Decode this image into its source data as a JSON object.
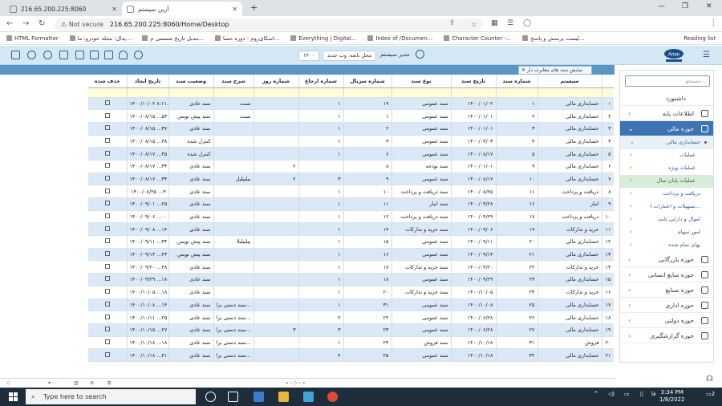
{
  "browser": {
    "tab1_title": "216.65.200.225:8060",
    "tab2_title": "آرین سیستم",
    "address_secure": "Not secure",
    "address_url": "216.65.200.225:8060/Home/Desktop",
    "bookmarks": [
      "HTML Formatter",
      "پدال: مجله خودرو، ما...",
      "تبدیل تاریخ شمسی م...",
      "اسکای‌روم - دوره حسا...",
      "Everything | Digital...",
      "Index of /Documen...",
      "Character Counter -...",
      "لیست پرسش و پاسخ..."
    ],
    "reading_list": "Reading list"
  },
  "app": {
    "logo_text": "Arian",
    "user_label": "مدیر سیستم",
    "branch_label": "محل تابعه: وب جدید",
    "year_label": "۱۴۰۰",
    "doc_tab": "نمایش سند های مغایرت دار"
  },
  "sidebar": {
    "search_placeholder": "جستجو...",
    "items": [
      {
        "label": "داشبورد"
      },
      {
        "label": "اطلاعات پایه"
      },
      {
        "label": "حوزه مالی"
      },
      {
        "label": "حسابداری مالی"
      },
      {
        "label": "عملیات"
      },
      {
        "label": "عملیات ویژه"
      },
      {
        "label": "عملیات پایان سال"
      },
      {
        "label": "دریافت و پرداخت"
      },
      {
        "label": "تسهیلات و اعتبارات ا..."
      },
      {
        "label": "اموال و دارایی ثابت"
      },
      {
        "label": "امور سهام"
      },
      {
        "label": "بهای تمام شده"
      },
      {
        "label": "حوزه بازرگانی"
      },
      {
        "label": "حوزه منابع انسانی"
      },
      {
        "label": "حوزه صنایع"
      },
      {
        "label": "حوزه اداری"
      },
      {
        "label": "حوزه دولتی"
      },
      {
        "label": "حوزه گزارشگیری"
      }
    ]
  },
  "grid": {
    "headers": [
      "",
      "سیستم",
      "شماره سند",
      "تاریخ سند",
      "نوع سند",
      "شماره سریال",
      "شماره ارجاع",
      "شماره روز",
      "شرح سند",
      "وضعیت سند",
      "تاریخ ایجاد",
      "حذف شده"
    ],
    "rows": [
      [
        "۱",
        "حسابداری مالی",
        "۱",
        "۱۴۰۰/۰۱/۰۲",
        "سند عمومی",
        "۱۹",
        "۱",
        "",
        "تست",
        "سند عادی",
        "۱۴۰۰/۱۰/۰۲ ۸:۱۱..."
      ],
      [
        "۲",
        "حسابداری مالی",
        "۲",
        "۱۴۰۰/۰۱/۰۱",
        "سند عمومی",
        "۱",
        "۱",
        "",
        "تست",
        "سند پیش نویس",
        "۱۴۰۰/۰۸/۱۵ ...۵۳"
      ],
      [
        "۳",
        "حسابداری مالی",
        "۳",
        "۱۴۰۰/۰۱/۰۱",
        "سند عمومی",
        "۲",
        "۱",
        "",
        "",
        "سند عادی",
        "۱۴۰۰/۰۸/۱۵ ...۳۷"
      ],
      [
        "۴",
        "حسابداری مالی",
        "۴",
        "۱۴۰۰/۰۳/۰۳",
        "سند عمومی",
        "۳",
        "۱",
        "",
        "",
        "کنترل شده",
        "۱۴۰۰/۰۸/۱۵ ...۳۸"
      ],
      [
        "۵",
        "حسابداری مالی",
        "۵",
        "۱۴۰۰/۰۸/۱۷",
        "سند عمومی",
        "۶",
        "۱",
        "",
        "",
        "کنترل شده",
        "۱۴۰۰/۰۸/۱۷ ...۴۵"
      ],
      [
        "۶",
        "حسابداری مالی",
        "۹",
        "۱۴۰۰/۰۱/۰۱",
        "سند بودجه",
        "۸",
        "",
        "۲",
        "",
        "سند عادی",
        "۱۴۰۰/۰۸/۱۷ ...۳۴"
      ],
      [
        "۷",
        "حسابداری مالی",
        "۱۰",
        "۱۴۰۰/۰۸/۱۷",
        "سند عمومی",
        "۹",
        "۳",
        "۲",
        "بیلبیلیل",
        "سند عادی",
        "۱۴۰۰/۰۸/۱۷ ...۳۴"
      ],
      [
        "۸",
        "دریافت و پرداخت",
        "۱۱",
        "۱۴۰۰/۰۸/۲۵",
        "سند دریافت و پرداخت",
        "۱۰",
        "۱",
        "",
        "",
        "سند عادی",
        "۱۴۰۰/۰۸/۲۵ ...۳"
      ],
      [
        "۹",
        "انبار",
        "۱۶",
        "۱۴۰۰/۰۴/۲۸",
        "سند انبار",
        "۱۱",
        "۱",
        "",
        "",
        "سند عادی",
        "۱۴۰۰/۰۹/۰۱ ...۲۵"
      ],
      [
        "۱۰",
        "دریافت و پرداخت",
        "۱۷",
        "۱۴۰۰/۰۴/۲۹",
        "سند دریافت و پرداخت",
        "۱۲",
        "۱",
        "",
        "",
        "سند عادی",
        "۱۴۰۰/۰۹/۰۶ ...۰۰"
      ],
      [
        "۱۱",
        "خرید و تدارکات",
        "۱۹",
        "۱۴۰۰/۰۹/۰۶",
        "سند خرید و تدارکات",
        "۱۴",
        "۱",
        "",
        "",
        "سند عادی",
        "۱۴۰۰/۰۹/۰۸ ...۱۴"
      ],
      [
        "۱۲",
        "حسابداری مالی",
        "۲۰",
        "۱۴۰۰/۰۹/۱۱",
        "سند عمومی",
        "۱۵",
        "۱",
        "",
        "بیلبیلبلا",
        "سند پیش نویس",
        "۱۴۰۰/۰۹/۱۱ ...۳۴"
      ],
      [
        "۱۳",
        "حسابداری مالی",
        "۲۱",
        "۱۴۰۰/۰۹/۱۳",
        "سند عمومی",
        "۱۶",
        "۱",
        "",
        "",
        "سند پیش نویس",
        "۱۴۰۰/۰۹/۱۳ ...۴۳"
      ],
      [
        "۱۴",
        "خرید و تدارکات",
        "۲۲",
        "۱۴۰۰/۰۴/۲۰",
        "سند خرید و تدارکات",
        "۱۷",
        "۱",
        "",
        "",
        "سند عادی",
        "۱۴۰۰/۰۹/۲۰ ...۴۸"
      ],
      [
        "۱۵",
        "حسابداری مالی",
        "۲۳",
        "۱۴۰۰/۰۹/۲۹",
        "سند عمومی",
        "۱۸",
        "۱",
        "",
        "",
        "سند عادی",
        "۱۴۰۰/۰۹/۲۹ ...۱۸"
      ],
      [
        "۱۶",
        "خرید و تدارکات",
        "۲۴",
        "۱۴۰۰/۱۰/۰۵",
        "سند خرید و تدارکات",
        "۲۰",
        "۱",
        "",
        "",
        "سند عادی",
        "۱۴۰۰/۱۰/۰۵ ...۱۸"
      ],
      [
        "۱۷",
        "حسابداری مالی",
        "۲۵",
        "۱۴۰۰/۱۰/۰۸",
        "سند عمومی",
        "۳۱",
        "۱",
        "",
        "سند دستی برا...",
        "سند عادی",
        "۱۴۰۰/۱۰/۰۸ ...۱۴"
      ],
      [
        "۱۸",
        "حسابداری مالی",
        "۲۶",
        "۱۴۰۰/۰۶/۲۸",
        "سند عمومی",
        "۲۲",
        "۲",
        "",
        "سند دستی برا...",
        "سند عادی",
        "۱۴۰۰/۱۰/۱۱ ...۲۵"
      ],
      [
        "۱۹",
        "حسابداری مالی",
        "۲۷",
        "۱۴۰۰/۰۶/۲۸",
        "سند عمومی",
        "۲۳",
        "۳",
        "۳",
        "سند دستی برا...",
        "سند عادی",
        "۱۴۰۰/۱۰/۱۵ ...۲۷"
      ],
      [
        "۲۰",
        "فروش",
        "۳۱",
        "۱۴۰۰/۱۰/۱۸",
        "سند فروش",
        "۲۴",
        "۱",
        "",
        "سند دستی برا...",
        "سند عادی",
        "۱۴۰۰/۱۰/۱۸ ...۱۸"
      ],
      [
        "۲۱",
        "حسابداری مالی",
        "۳۲",
        "۱۴۰۰/۱۰/۱۸",
        "سند عمومی",
        "۲۵",
        "۴",
        "",
        "سند دستی برا...",
        "سند عادی",
        "۱۴۰۰/۱۰/۱۸ ...۴۱"
      ]
    ]
  },
  "taskbar": {
    "search_placeholder": "Type here to search",
    "time": "3:34 PM",
    "date": "1/8/2022",
    "notif_count": "2"
  }
}
